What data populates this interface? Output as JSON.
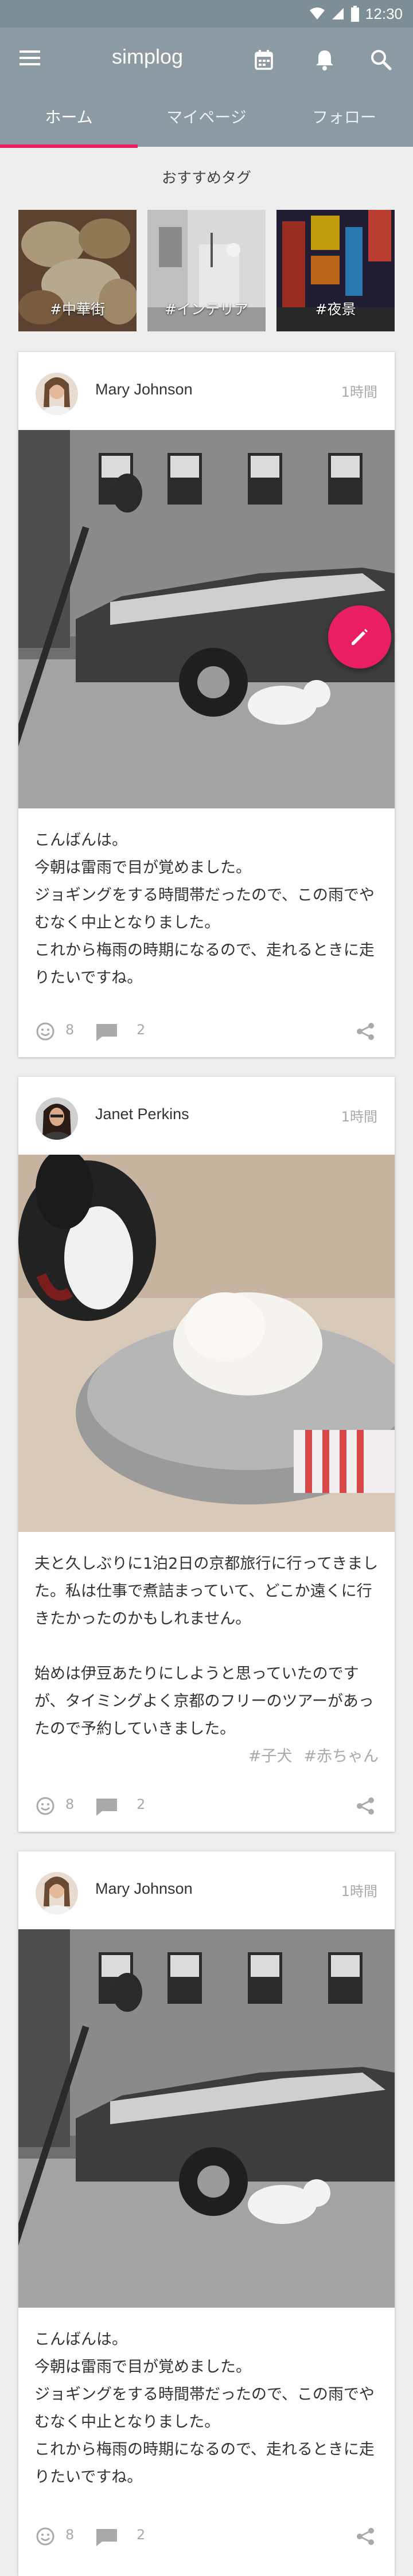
{
  "status_bar": {
    "time": "12:30"
  },
  "app_bar": {
    "title": "simplog"
  },
  "tabs": [
    {
      "label": "ホーム",
      "active": true
    },
    {
      "label": "マイページ",
      "active": false
    },
    {
      "label": "フォロー",
      "active": false
    }
  ],
  "recommended": {
    "title": "おすすめタグ",
    "tags": [
      {
        "label": "#中華街"
      },
      {
        "label": "#インテリア"
      },
      {
        "label": "#夜景"
      }
    ]
  },
  "posts": [
    {
      "author": "Mary Johnson",
      "time": "1時間",
      "paragraphs": [
        "こんばんは。\n今朝は雷雨で目が覚めました。\nジョギングをする時間帯だったので、この雨でやむなく中止となりました。\nこれから梅雨の時期になるので、走れるときに走りたいですね。"
      ],
      "tags": [],
      "likes": "8",
      "comments": "2"
    },
    {
      "author": "Janet Perkins",
      "time": "1時間",
      "paragraphs": [
        "夫と久しぶりに1泊2日の京都旅行に行ってきました。私は仕事で煮詰まっていて、どこか遠くに行きたかったのかもしれません。",
        "始めは伊豆あたりにしようと思っていたのですが、タイミングよく京都のフリーのツアーがあったので予約していきました。"
      ],
      "tags": [
        "#子犬",
        "#赤ちゃん"
      ],
      "likes": "8",
      "comments": "2"
    },
    {
      "author": "Mary Johnson",
      "time": "1時間",
      "paragraphs": [
        "こんばんは。\n今朝は雷雨で目が覚めました。\nジョギングをする時間帯だったので、この雨でやむなく中止となりました。\nこれから梅雨の時期になるので、走れるときに走りたいですね。"
      ],
      "tags": [],
      "likes": "8",
      "comments": "2"
    }
  ],
  "colors": {
    "app_bar": "#8c9aa3",
    "accent": "#e91e63",
    "background": "#eeeeee"
  }
}
